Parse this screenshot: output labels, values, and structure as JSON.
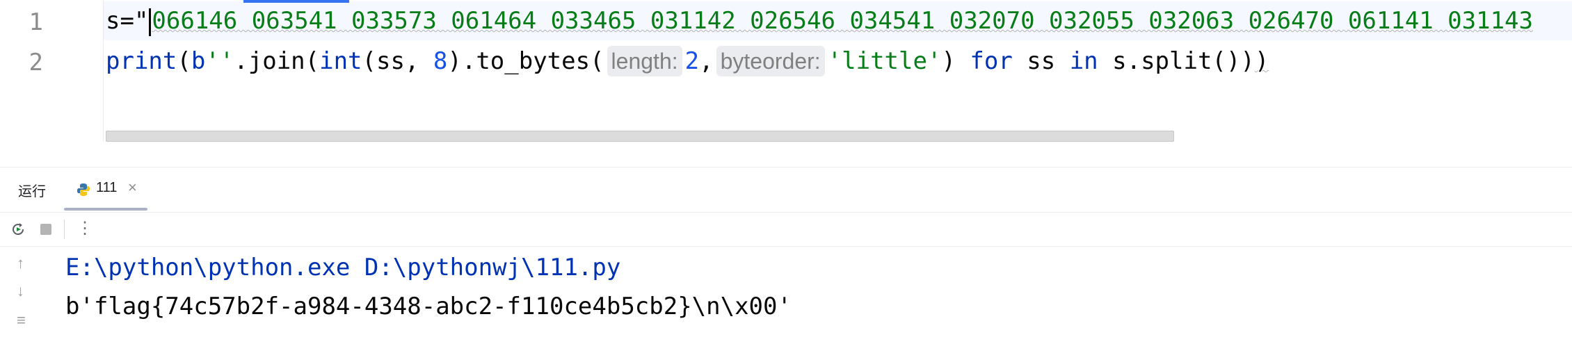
{
  "editor": {
    "line_numbers": [
      "1",
      "2"
    ],
    "line1": {
      "prefix": "s=\"",
      "string_value": "066146 063541 033573 061464 033465 031142 026546 034541 032070 032055 032063 026470 061141 031143"
    },
    "line2": {
      "print": "print",
      "paren_open": "(",
      "b_prefix": "b",
      "empty_str": "''",
      "join": ".join(",
      "int": "int",
      "int_args": "(ss, ",
      "eight": "8",
      "to_bytes": ").to_bytes(",
      "hint_length": "length:",
      "two": "2",
      "comma": ",",
      "hint_byteorder": "byteorder:",
      "little": "'little'",
      "close1": ") ",
      "for": "for",
      "ss": " ss ",
      "in": "in",
      "tail": " s.split())",
      "last_paren": ")"
    }
  },
  "run_window": {
    "title": "运行",
    "tab_label": "111",
    "tab_close": "×",
    "console": [
      "E:\\python\\python.exe D:\\pythonwj\\111.py",
      "b'flag{74c57b2f-a984-4348-abc2-f110ce4b5cb2}\\n\\x00'"
    ]
  },
  "icons": {
    "rerun": "rerun-icon",
    "stop": "stop-icon",
    "more": "more-icon",
    "up": "arrow-up-icon",
    "down": "arrow-down-icon",
    "wrap": "soft-wrap-icon",
    "python": "python-icon"
  },
  "colors": {
    "accent": "#3574f0",
    "string": "#067d17",
    "keyword": "#0033b3",
    "number": "#1750eb"
  }
}
